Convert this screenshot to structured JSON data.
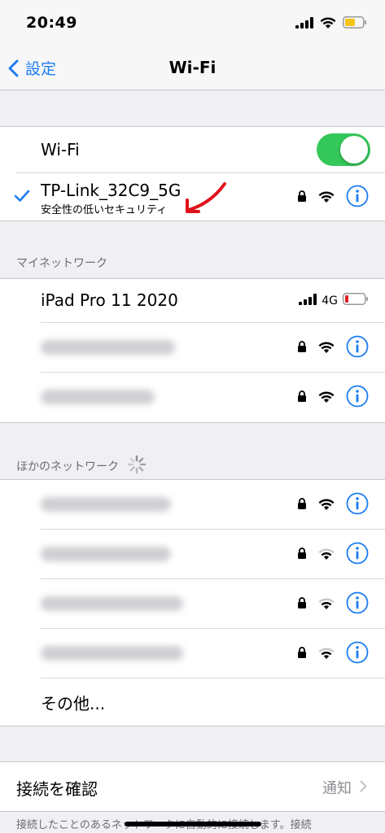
{
  "status_bar": {
    "time": "20:49"
  },
  "nav": {
    "back_label": "設定",
    "title": "Wi-Fi"
  },
  "wifi": {
    "toggle_label": "Wi-Fi",
    "connected": {
      "ssid": "TP-Link_32C9_5G",
      "subtitle": "安全性の低いセキュリティ"
    }
  },
  "my_networks": {
    "header": "マイネットワーク",
    "hotspot": {
      "name": "iPad Pro 11 2020",
      "cellular": "4G"
    }
  },
  "other_networks": {
    "header": "ほかのネットワーク",
    "other_label": "その他..."
  },
  "ask_join": {
    "label": "接続を確認",
    "value": "通知"
  },
  "footer": {
    "text": "接続したことのあるネットワークに自動的に接続します。接続"
  },
  "colors": {
    "accent": "#1a7cf2",
    "toggle_on": "#34c759",
    "annotation": "#e0101a",
    "battery_low": "#e02020"
  }
}
